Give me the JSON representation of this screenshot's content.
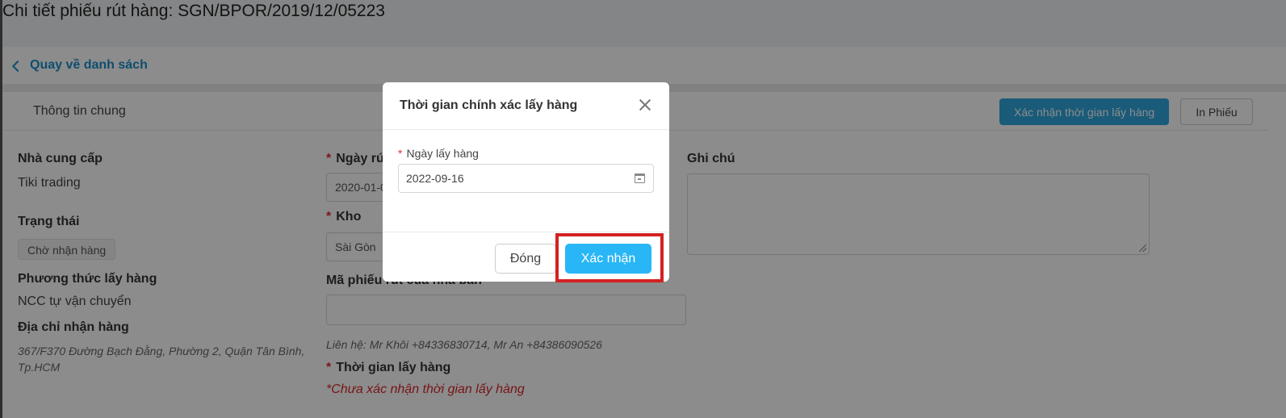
{
  "page": {
    "title": "Chi tiết phiếu rút hàng: SGN/BPOR/2019/12/05223"
  },
  "nav": {
    "back_label": "Quay về danh sách"
  },
  "card": {
    "title": "Thông tin chung",
    "confirm_time_button": "Xác nhận thời gian lấy hàng",
    "print_button": "In Phiếu"
  },
  "info": {
    "supplier_label": "Nhà cung cấp",
    "supplier_value": "Tiki trading",
    "status_label": "Trạng thái",
    "status_value": "Chờ nhận hàng",
    "pickup_method_label": "Phương thức lấy hàng",
    "pickup_method_value": "NCC tự vận chuyển",
    "address_label": "Địa chỉ nhận hàng",
    "address_value": "367/F370 Đường Bạch Đằng, Phường 2, Quận Tân Bình, Tp.HCM"
  },
  "form": {
    "withdraw_date_label": "Ngày rú",
    "withdraw_date_value": "2020-01-0",
    "warehouse_label": "Kho",
    "warehouse_value": "Sài Gòn",
    "supplier_code_label": "Mã phiếu rút của nhà bán",
    "supplier_code_value": "",
    "contact": "Liên hệ: Mr Khôi +84336830714, Mr An +84386090526",
    "pickup_time_label": "Thời gian lấy hàng",
    "pickup_time_warning": "*Chưa xác nhận thời gian lấy hàng",
    "note_label": "Ghi chú",
    "required_mark": "*"
  },
  "modal": {
    "title": "Thời gian chính xác lấy hàng",
    "field_label": "Ngày lấy hàng",
    "date_value": "2022-09-16",
    "close_button": "Đóng",
    "confirm_button": "Xác nhận"
  },
  "colors": {
    "accent": "#29b6f6",
    "link": "#1a8fc9",
    "required": "#e0302e",
    "highlight": "#d42121"
  }
}
